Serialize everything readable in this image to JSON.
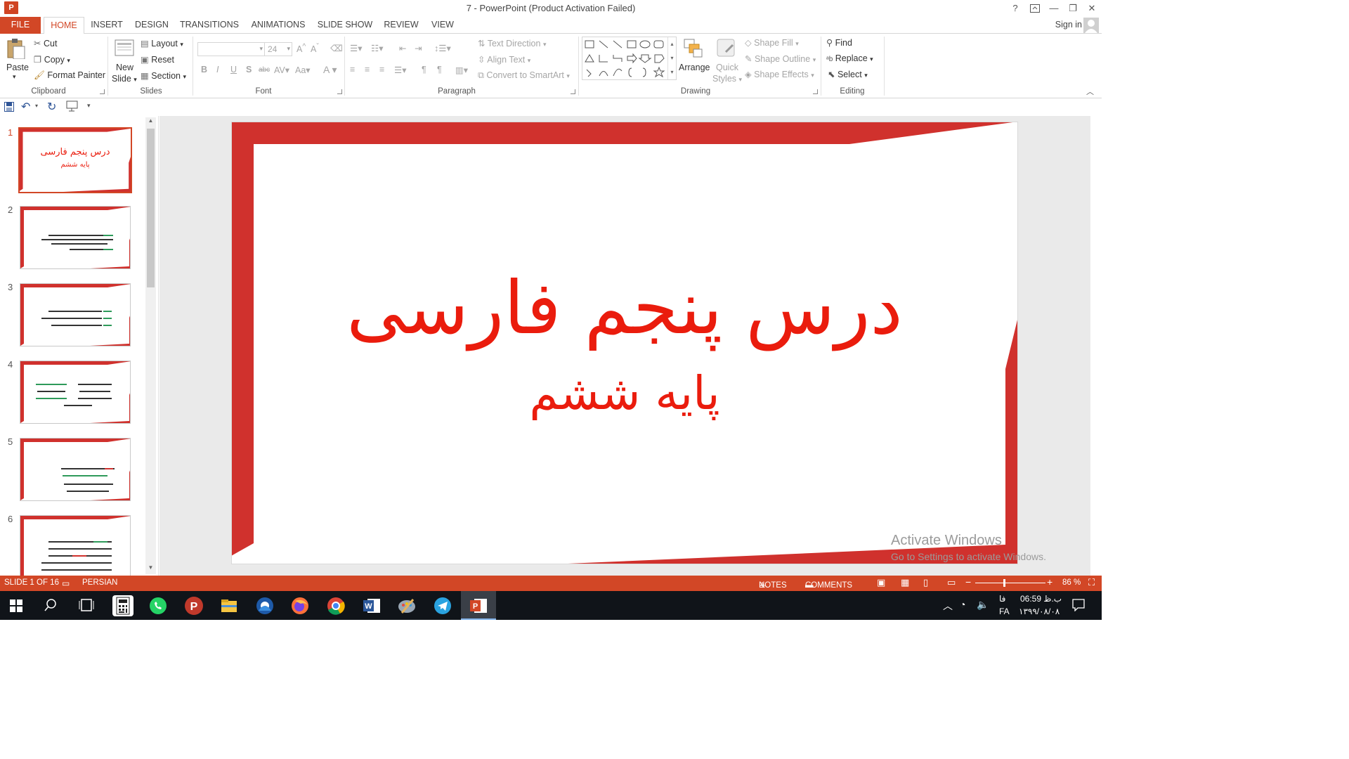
{
  "window": {
    "title": "7 - PowerPoint (Product Activation Failed)",
    "app_icon_text": "P",
    "help": "?",
    "minimize": "—",
    "restore": "❐",
    "close": "✕"
  },
  "tabs": {
    "file": "FILE",
    "home": "HOME",
    "insert": "INSERT",
    "design": "DESIGN",
    "transitions": "TRANSITIONS",
    "animations": "ANIMATIONS",
    "slideshow": "SLIDE SHOW",
    "review": "REVIEW",
    "view": "VIEW",
    "signin": "Sign in"
  },
  "ribbon": {
    "clipboard": {
      "paste": "Paste",
      "cut": "Cut",
      "copy": "Copy",
      "format_painter": "Format Painter",
      "label": "Clipboard"
    },
    "slides": {
      "new_slide_1": "New",
      "new_slide_2": "Slide",
      "layout": "Layout",
      "reset": "Reset",
      "section": "Section",
      "label": "Slides"
    },
    "font": {
      "font_name": "",
      "font_size": "24",
      "label": "Font"
    },
    "paragraph": {
      "text_direction": "Text Direction",
      "align_text": "Align Text",
      "convert_smartart": "Convert to SmartArt",
      "label": "Paragraph"
    },
    "drawing": {
      "arrange": "Arrange",
      "quick_styles_1": "Quick",
      "quick_styles_2": "Styles",
      "shape_fill": "Shape Fill",
      "shape_outline": "Shape Outline",
      "shape_effects": "Shape Effects",
      "label": "Drawing"
    },
    "editing": {
      "find": "Find",
      "replace": "Replace",
      "select": "Select",
      "label": "Editing"
    }
  },
  "thumbnails": [
    {
      "num": "1",
      "title": "درس پنجم فارسی",
      "subtitle": "پایه ششم"
    },
    {
      "num": "2"
    },
    {
      "num": "3"
    },
    {
      "num": "4"
    },
    {
      "num": "5"
    },
    {
      "num": "6"
    }
  ],
  "slide": {
    "title": "درس پنجم فارسی",
    "subtitle": "پایه ششم",
    "accent_color": "#d0312d",
    "text_color": "#ea1c0d"
  },
  "watermark": {
    "line1": "Activate Windows",
    "line2": "Go to Settings to activate Windows."
  },
  "status": {
    "slide_info": "SLIDE 1 OF 16",
    "language": "PERSIAN",
    "notes": "NOTES",
    "comments": "COMMENTS",
    "zoom": "86 %"
  },
  "taskbar": {
    "time": "06:59 ب.ظ",
    "date": "۱۳۹۹/۰۸/۰۸",
    "lang": "FA",
    "lang2": "فا"
  }
}
